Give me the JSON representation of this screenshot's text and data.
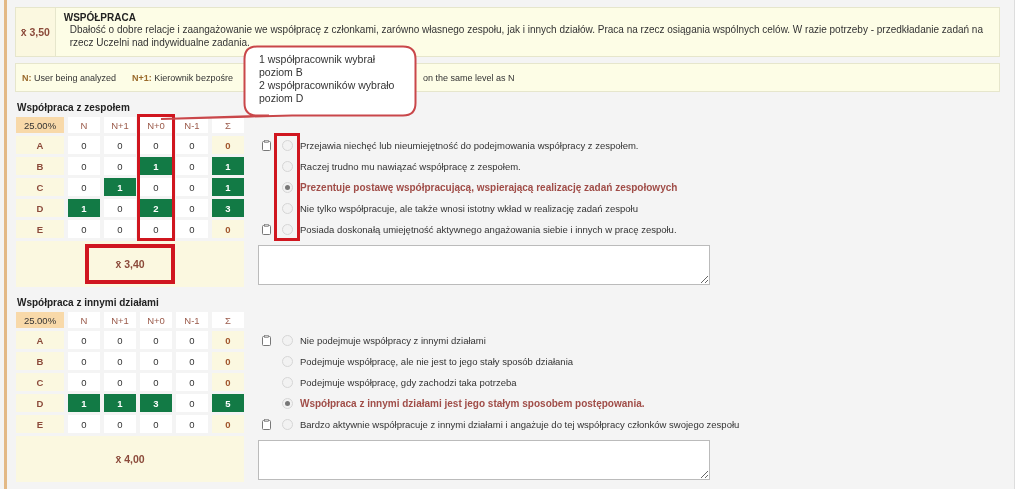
{
  "competency": {
    "score": "x̄ 3,50",
    "title": "WSPÓŁPRACA",
    "description": "Dbałość o dobre relacje i zaangażowanie we współpracę z członkami, zarówno własnego zespołu, jak i innych działów. Praca na rzecz osiągania wspólnych celów. W razie potrzeby - przedkładanie zadań na rzecz Uczelni nad indywidualne zadania."
  },
  "legend": [
    {
      "key": "N:",
      "text": "User being analyzed"
    },
    {
      "key": "N+1:",
      "text": "Kierownik bezpośre"
    }
  ],
  "legend_tail": "on the same level as N",
  "callout": [
    "1 współpracownik wybrał",
    "poziom B",
    "2 współpracowników wybrało",
    "poziom D"
  ],
  "sections": [
    {
      "title": "Współpraca z zespołem",
      "weight": "25.00%",
      "mean": "x̄ 3,40",
      "mean_framed": true,
      "radios_framed": true,
      "columns": [
        {
          "label": "N",
          "framed": false
        },
        {
          "label": "N+1",
          "framed": false
        },
        {
          "label": "N+0",
          "framed": true
        },
        {
          "label": "N-1",
          "framed": false
        },
        {
          "label": "Σ",
          "framed": false
        }
      ],
      "rows": [
        {
          "label": "A",
          "cells": [
            {
              "value": "0",
              "highlight": false
            },
            {
              "value": "0",
              "highlight": false
            },
            {
              "value": "0",
              "highlight": false
            },
            {
              "value": "0",
              "highlight": false
            }
          ],
          "total": {
            "value": "0",
            "highlight": false
          },
          "note": true,
          "option": "Przejawia niechęć lub nieumiejętność do podejmowania współpracy z zespołem.",
          "selected": false
        },
        {
          "label": "B",
          "cells": [
            {
              "value": "0",
              "highlight": false
            },
            {
              "value": "0",
              "highlight": false
            },
            {
              "value": "1",
              "highlight": true
            },
            {
              "value": "0",
              "highlight": false
            }
          ],
          "total": {
            "value": "1",
            "highlight": true
          },
          "note": false,
          "option": "Raczej trudno mu nawiązać współpracę z zespołem.",
          "selected": false
        },
        {
          "label": "C",
          "cells": [
            {
              "value": "0",
              "highlight": false
            },
            {
              "value": "1",
              "highlight": true
            },
            {
              "value": "0",
              "highlight": false
            },
            {
              "value": "0",
              "highlight": false
            }
          ],
          "total": {
            "value": "1",
            "highlight": true
          },
          "note": false,
          "option": "Prezentuje postawę współpracującą, wspierającą realizację zadań zespołowych",
          "selected": true
        },
        {
          "label": "D",
          "cells": [
            {
              "value": "1",
              "highlight": true
            },
            {
              "value": "0",
              "highlight": false
            },
            {
              "value": "2",
              "highlight": true
            },
            {
              "value": "0",
              "highlight": false
            }
          ],
          "total": {
            "value": "3",
            "highlight": true
          },
          "note": false,
          "option": "Nie tylko współpracuje, ale także wnosi istotny wkład w realizację zadań zespołu",
          "selected": false
        },
        {
          "label": "E",
          "cells": [
            {
              "value": "0",
              "highlight": false
            },
            {
              "value": "0",
              "highlight": false
            },
            {
              "value": "0",
              "highlight": false
            },
            {
              "value": "0",
              "highlight": false
            }
          ],
          "total": {
            "value": "0",
            "highlight": false
          },
          "note": true,
          "option": "Posiada doskonałą umiejętność aktywnego angażowania siebie i innych w pracę zespołu.",
          "selected": false
        }
      ]
    },
    {
      "title": "Współpraca z innymi działami",
      "weight": "25.00%",
      "mean": "x̄ 4,00",
      "mean_framed": false,
      "radios_framed": false,
      "columns": [
        {
          "label": "N",
          "framed": false
        },
        {
          "label": "N+1",
          "framed": false
        },
        {
          "label": "N+0",
          "framed": false
        },
        {
          "label": "N-1",
          "framed": false
        },
        {
          "label": "Σ",
          "framed": false
        }
      ],
      "rows": [
        {
          "label": "A",
          "cells": [
            {
              "value": "0",
              "highlight": false
            },
            {
              "value": "0",
              "highlight": false
            },
            {
              "value": "0",
              "highlight": false
            },
            {
              "value": "0",
              "highlight": false
            }
          ],
          "total": {
            "value": "0",
            "highlight": false
          },
          "note": true,
          "option": "Nie podejmuje współpracy z innymi działami",
          "selected": false
        },
        {
          "label": "B",
          "cells": [
            {
              "value": "0",
              "highlight": false
            },
            {
              "value": "0",
              "highlight": false
            },
            {
              "value": "0",
              "highlight": false
            },
            {
              "value": "0",
              "highlight": false
            }
          ],
          "total": {
            "value": "0",
            "highlight": false
          },
          "note": false,
          "option": "Podejmuje współpracę, ale nie jest to jego stały sposób działania",
          "selected": false
        },
        {
          "label": "C",
          "cells": [
            {
              "value": "0",
              "highlight": false
            },
            {
              "value": "0",
              "highlight": false
            },
            {
              "value": "0",
              "highlight": false
            },
            {
              "value": "0",
              "highlight": false
            }
          ],
          "total": {
            "value": "0",
            "highlight": false
          },
          "note": false,
          "option": "Podejmuje współpracę, gdy zachodzi taka potrzeba",
          "selected": false
        },
        {
          "label": "D",
          "cells": [
            {
              "value": "1",
              "highlight": true
            },
            {
              "value": "1",
              "highlight": true
            },
            {
              "value": "3",
              "highlight": true
            },
            {
              "value": "0",
              "highlight": false
            }
          ],
          "total": {
            "value": "5",
            "highlight": true
          },
          "note": false,
          "option": "Współpraca z innymi działami jest jego stałym sposobem postępowania.",
          "selected": true
        },
        {
          "label": "E",
          "cells": [
            {
              "value": "0",
              "highlight": false
            },
            {
              "value": "0",
              "highlight": false
            },
            {
              "value": "0",
              "highlight": false
            },
            {
              "value": "0",
              "highlight": false
            }
          ],
          "total": {
            "value": "0",
            "highlight": false
          },
          "note": true,
          "option": "Bardzo aktywnie współpracuje z innymi działami i angażuje do tej współpracy członków swojego zespołu",
          "selected": false
        }
      ]
    }
  ]
}
